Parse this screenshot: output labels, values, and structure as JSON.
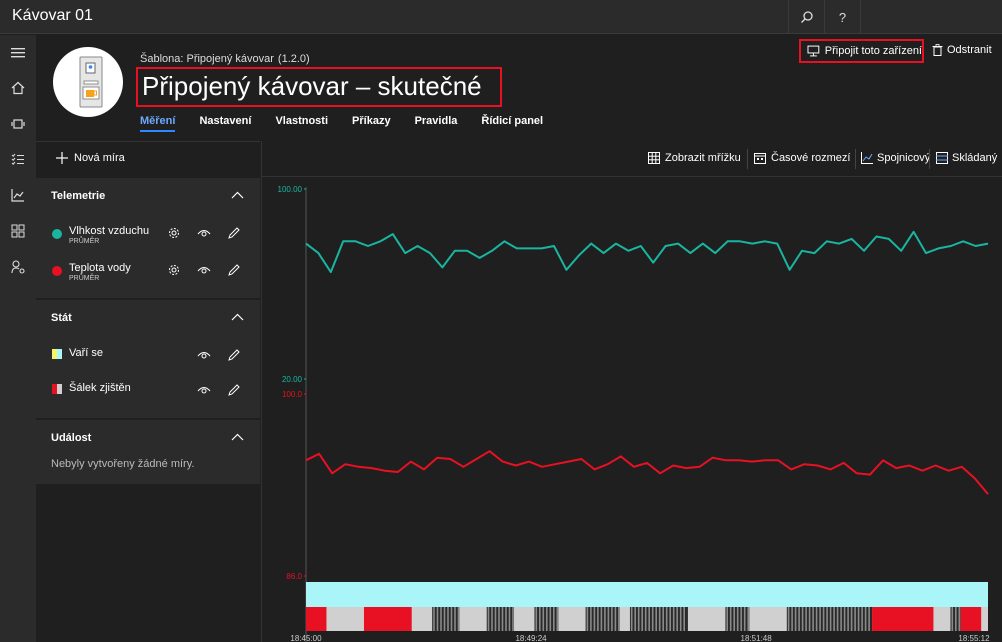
{
  "app": {
    "title": "Kávovar 01"
  },
  "topbar": {
    "search_icon": "search-icon",
    "help_label": "?"
  },
  "header": {
    "template_label": "Šablona: Připojený kávovar",
    "template_version": "(1.2.0)",
    "device_title": "Připojený kávovar – skutečné",
    "connect_label": "Připojit toto zařízení",
    "delete_label": "Odstranit"
  },
  "tabs": [
    {
      "label": "Měření",
      "active": true
    },
    {
      "label": "Nastavení"
    },
    {
      "label": "Vlastnosti"
    },
    {
      "label": "Příkazy"
    },
    {
      "label": "Pravidla"
    },
    {
      "label": "Řídicí panel"
    }
  ],
  "panel": {
    "new_measure_label": "Nová míra",
    "telemetry": {
      "title": "Telemetrie",
      "items": [
        {
          "name": "Vlhkost vzduchu",
          "sub": "PRŮMĚR",
          "color": "#1ab5a0"
        },
        {
          "name": "Teplota vody",
          "sub": "PRŮMĚR",
          "color": "#e81123"
        }
      ]
    },
    "state": {
      "title": "Stát",
      "items": [
        {
          "name": "Vaří se",
          "color": "#f7f26e"
        },
        {
          "name": "Šálek zjištěn",
          "color": "#e81123"
        }
      ]
    },
    "event": {
      "title": "Událost",
      "empty": "Nebyly vytvořeny žádné míry."
    }
  },
  "chart_toolbar": {
    "grid": "Zobrazit mřížku",
    "time_range": "Časové rozmezí",
    "line": "Spojnicový",
    "stacked": "Skládaný"
  },
  "chart_data": {
    "type": "line",
    "x_ticks": [
      "18:45:00",
      "18:49:24",
      "18:51:48",
      "18:55:12"
    ],
    "series": [
      {
        "name": "Vlhkost vzduchu",
        "color": "#1ab5a0",
        "y_axis_labels": [
          "100.00",
          "20.00"
        ],
        "values": [
          77,
          73,
          65,
          78,
          78,
          76,
          78,
          81,
          73,
          76,
          73,
          67,
          74,
          74,
          71,
          74,
          78,
          75,
          75,
          75,
          76,
          66,
          72,
          77,
          73,
          77,
          74,
          76,
          69,
          76,
          77,
          73,
          77,
          73,
          78,
          78,
          77,
          78,
          77,
          66,
          74,
          73,
          78,
          77,
          79,
          74,
          80,
          79,
          74,
          82,
          73,
          75,
          76,
          78,
          76,
          77
        ]
      },
      {
        "name": "Teplota vody",
        "color": "#e81123",
        "y_axis_labels": [
          "100.0",
          "86.0"
        ],
        "values": [
          94.9,
          95.4,
          93.9,
          94.6,
          94.4,
          94.3,
          94.1,
          94.0,
          94.8,
          94.2,
          95.1,
          95.0,
          94.4,
          95.0,
          95.6,
          94.8,
          94.5,
          94.8,
          94.4,
          94.6,
          94.8,
          95.0,
          94.2,
          94.6,
          95.2,
          94.4,
          94.7,
          93.9,
          94.5,
          94.3,
          94.4,
          95.1,
          94.9,
          94.9,
          94.8,
          94.9,
          94.9,
          94.2,
          94.6,
          94.5,
          94.2,
          94.7,
          93.9,
          93.8,
          94.9,
          94.3,
          94.5,
          94.1,
          94.5,
          94.1,
          94.4,
          93.5,
          92.3
        ]
      }
    ],
    "states": {
      "brewing": {
        "name": "Vaří se",
        "color": "#a9f5f8"
      },
      "cup": {
        "name": "Šálek zjištěn",
        "segments": [
          [
            0.0,
            0.03,
            "r"
          ],
          [
            0.03,
            0.085,
            "s"
          ],
          [
            0.085,
            0.155,
            "r"
          ],
          [
            0.155,
            0.185,
            "s"
          ],
          [
            0.185,
            0.225,
            "g"
          ],
          [
            0.225,
            0.265,
            "s"
          ],
          [
            0.265,
            0.305,
            "g"
          ],
          [
            0.305,
            0.335,
            "s"
          ],
          [
            0.335,
            0.37,
            "g"
          ],
          [
            0.37,
            0.41,
            "s"
          ],
          [
            0.41,
            0.46,
            "g"
          ],
          [
            0.46,
            0.475,
            "s"
          ],
          [
            0.475,
            0.56,
            "g"
          ],
          [
            0.56,
            0.615,
            "s"
          ],
          [
            0.615,
            0.65,
            "g"
          ],
          [
            0.65,
            0.705,
            "s"
          ],
          [
            0.705,
            0.83,
            "g"
          ],
          [
            0.83,
            0.92,
            "r"
          ],
          [
            0.92,
            0.945,
            "s"
          ],
          [
            0.945,
            0.96,
            "g"
          ],
          [
            0.96,
            0.99,
            "r"
          ],
          [
            0.99,
            1.0,
            "s"
          ]
        ]
      }
    }
  },
  "colors": {
    "accent": "#2b88ff",
    "highlight": "#e81123",
    "bg": "#1f1f1f",
    "panel": "#2b2b2b"
  }
}
